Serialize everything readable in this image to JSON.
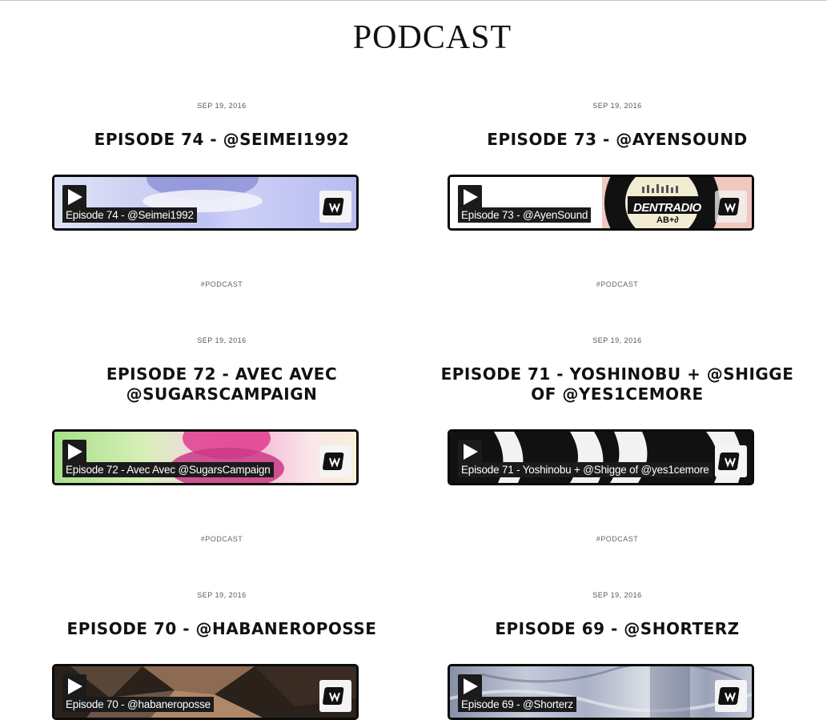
{
  "page": {
    "title": "PODCAST"
  },
  "posts": [
    {
      "date": "SEP 19, 2016",
      "title": "EPISODE 74 - @SEIMEI1992",
      "player_label": "Episode 74 - @Seimei1992",
      "tag": "#PODCAST"
    },
    {
      "date": "SEP 19, 2016",
      "title": "EPISODE 73 - @AYENSOUND",
      "player_label": "Episode 73 - @AyenSound",
      "tag": "#PODCAST",
      "art_text": "DENTRADIO",
      "art_subtext": "AB+∂"
    },
    {
      "date": "SEP 19, 2016",
      "title": "EPISODE 72 - AVEC AVEC @SUGARSCAMPAIGN",
      "player_label": "Episode 72 - Avec Avec @SugarsCampaign",
      "tag": "#PODCAST"
    },
    {
      "date": "SEP 19, 2016",
      "title": "EPISODE 71 - YOSHINOBU + @SHIGGE OF @YES1CEMORE",
      "player_label": "Episode 71 - Yoshinobu + @Shigge of @yes1cemore",
      "tag": "#PODCAST"
    },
    {
      "date": "SEP 19, 2016",
      "title": "EPISODE 70 - @HABANEROPOSSE",
      "player_label": "Episode 70 - @habaneroposse"
    },
    {
      "date": "SEP 19, 2016",
      "title": "EPISODE 69 - @SHORTERZ",
      "player_label": "Episode 69 - @Shorterz"
    }
  ],
  "icons": {
    "play": "play-icon",
    "mixcloud": "mixcloud-logo-icon"
  },
  "colors": {
    "frame": "#0b0b0b",
    "label_bg": "#1b1b1b",
    "label_text": "#ffffff"
  }
}
